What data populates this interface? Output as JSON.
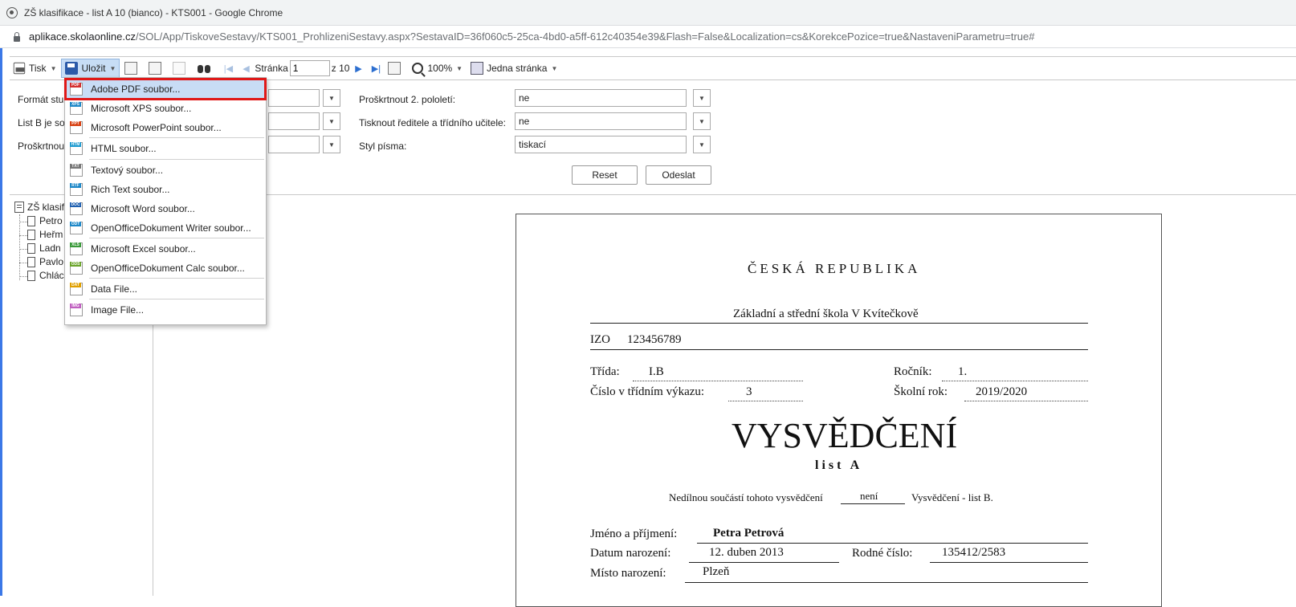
{
  "window": {
    "title": "ZŠ klasifikace - list A 10 (bianco) - KTS001 - Google Chrome",
    "url_domain": "aplikace.skolaonline.cz",
    "url_path": "/SOL/App/TiskoveSestavy/KTS001_ProhlizeniSestavy.aspx?SestavaID=36f060c5-25ca-4bd0-a5ff-612c40354e39&Flash=False&Localization=cs&KorekcePozice=true&NastaveniParametru=true#"
  },
  "toolbar": {
    "print_label": "Tisk",
    "save_label": "Uložit",
    "page_label": "Stránka",
    "page_value": "1",
    "page_total": "z 10",
    "zoom_label": "100%",
    "view_label": "Jedna stránka"
  },
  "params": {
    "left_labels": [
      "Formát stu",
      "List B je so",
      "Proškrtnou"
    ],
    "right_labels": [
      "Proškrtnout 2. pololetí:",
      "Tisknout ředitele a třídního učitele:",
      "Styl písma:"
    ],
    "right_values": [
      "ne",
      "ne",
      "tiskací"
    ],
    "reset_label": "Reset",
    "submit_label": "Odeslat"
  },
  "tree": {
    "root": "ZŠ klasif",
    "items": [
      "Petro",
      "Heřm",
      "Ladn",
      "Pavlo",
      "Chlác"
    ]
  },
  "save_menu": {
    "items": [
      {
        "label": "Adobe PDF soubor...",
        "icon": "pdf-icon",
        "tag": "PDF",
        "color": "#d32f2f"
      },
      {
        "label": "Microsoft XPS soubor...",
        "icon": "xps-icon",
        "tag": "XPS",
        "color": "#1e88c8"
      },
      {
        "label": "Microsoft PowerPoint soubor...",
        "icon": "ppt-icon",
        "tag": "PPT",
        "color": "#d84315"
      },
      {
        "label": "HTML soubor...",
        "icon": "html-icon",
        "tag": "HTM",
        "color": "#1e9bd0"
      },
      {
        "label": "Textový soubor...",
        "icon": "txt-icon",
        "tag": "TXT",
        "color": "#777777"
      },
      {
        "label": "Rich Text soubor...",
        "icon": "rtf-icon",
        "tag": "RTF",
        "color": "#1e88c8"
      },
      {
        "label": "Microsoft Word soubor...",
        "icon": "word-icon",
        "tag": "DOC",
        "color": "#1e5fb0"
      },
      {
        "label": "OpenOfficeDokument Writer soubor...",
        "icon": "odt-icon",
        "tag": "ODT",
        "color": "#1e88c8"
      },
      {
        "label": "Microsoft Excel soubor...",
        "icon": "excel-icon",
        "tag": "XLS",
        "color": "#3a9a3a"
      },
      {
        "label": "OpenOfficeDokument Calc soubor...",
        "icon": "ods-icon",
        "tag": "ODS",
        "color": "#6aa42a"
      },
      {
        "label": "Data File...",
        "icon": "data-icon",
        "tag": "DAT",
        "color": "#e0a000"
      },
      {
        "label": "Image File...",
        "icon": "image-icon",
        "tag": "IMG",
        "color": "#c060c0"
      }
    ]
  },
  "document": {
    "country": "ČESKÁ REPUBLIKA",
    "school": "Základní a střední škola V Kvítečkově",
    "izo_label": "IZO",
    "izo_value": "123456789",
    "class_label": "Třída:",
    "class_value": "I.B",
    "year_label": "Ročník:",
    "year_value": "1.",
    "register_label": "Číslo v třídním výkazu:",
    "register_value": "3",
    "school_year_label": "Školní rok:",
    "school_year_value": "2019/2020",
    "heading": "VYSVĚDČENÍ",
    "subheading": "list A",
    "note_prefix": "Nedílnou součástí tohoto vysvědčení",
    "note_value": "není",
    "note_suffix": "Vysvědčení - list B.",
    "name_label": "Jméno a příjmení:",
    "name_value": "Petra Petrová",
    "birth_label": "Datum narození:",
    "birth_value": "12. duben 2013",
    "id_label": "Rodné číslo:",
    "id_value": "135412/2583",
    "place_label": "Místo narození:",
    "place_value": "Plzeň"
  }
}
